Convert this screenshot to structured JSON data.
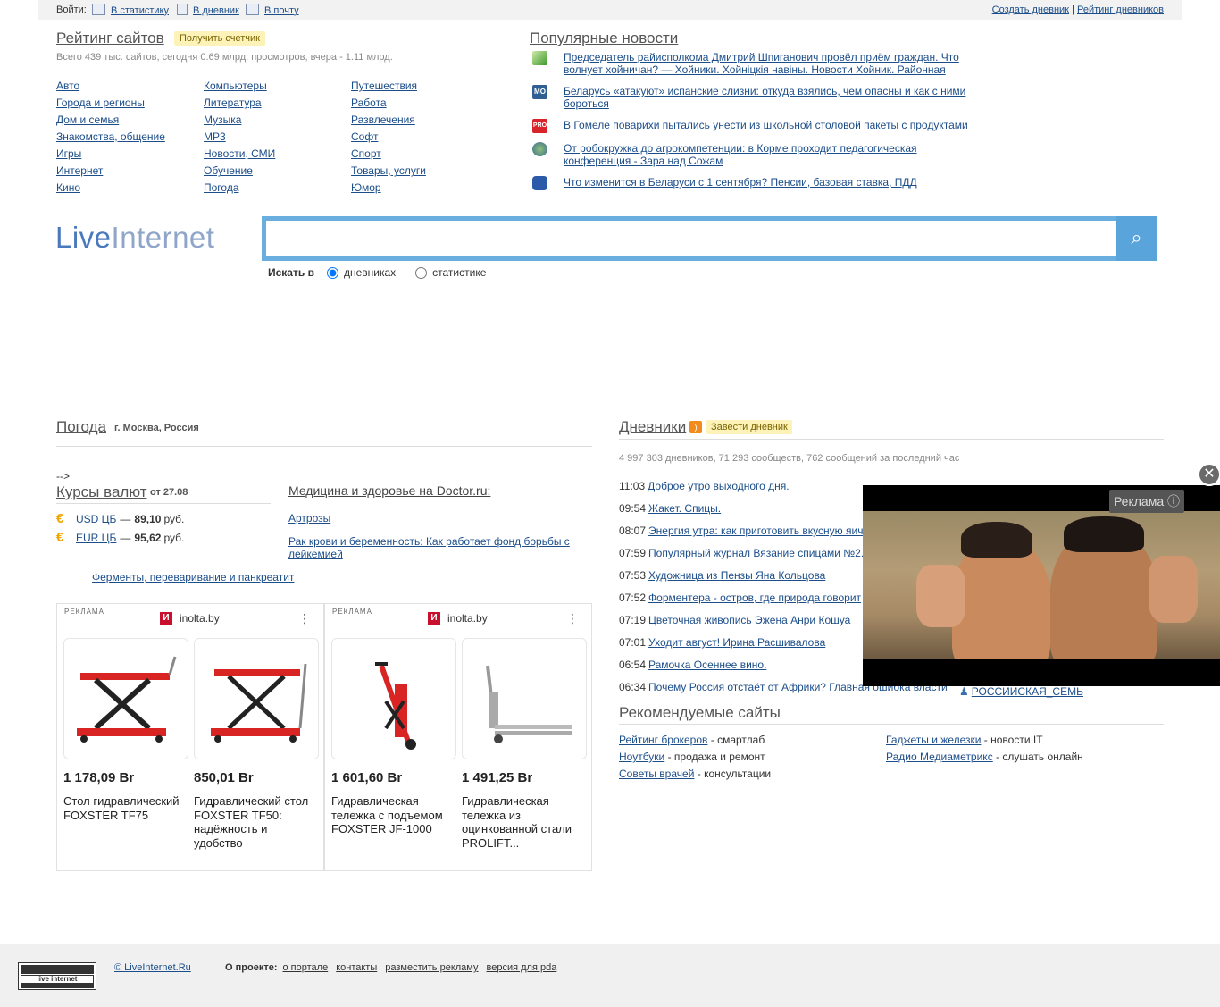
{
  "topbar": {
    "login_label": "Войти:",
    "links": [
      "В статистику",
      "В дневник",
      "В почту"
    ],
    "create_diary": "Создать дневник",
    "separator": "|",
    "diary_rating": "Рейтинг дневников"
  },
  "rating": {
    "title": "Рейтинг сайтов",
    "badge": "Получить счетчик",
    "stats": "Всего 439 тыс. сайтов, сегодня 0.69 млрд. просмотров, вчера - 1.11 млрд.",
    "col1": [
      "Авто",
      "Города и регионы",
      "Дом и семья",
      "Знакомства, общение",
      "Игры",
      "Интернет",
      "Кино"
    ],
    "col2": [
      "Компьютеры",
      "Литература",
      "Музыка",
      "MP3",
      "Новости, СМИ",
      "Обучение",
      "Погода"
    ],
    "col3": [
      "Путешествия",
      "Работа",
      "Развлечения",
      "Софт",
      "Спорт",
      "Товары, услуги",
      "Юмор"
    ]
  },
  "news": {
    "title": "Популярные новости",
    "items": [
      {
        "icon": "green-leaf-icon",
        "text": "Председатель райисполкома Дмитрий Шпиганович провёл приём граждан. Что волнует хойничан? — Хойники. Хойніцкія навіны. Новости Хойник. Районная"
      },
      {
        "icon": "mo-logo-icon",
        "badge": "MO",
        "text": "Беларусь «атакуют» испанские слизни: откуда взялись, чем опасны и как с ними бороться"
      },
      {
        "icon": "pro-logo-icon",
        "badge": "PRO",
        "text": "В Гомеле поварихи пытались унести из школьной столовой пакеты с продуктами"
      },
      {
        "icon": "globe-icon",
        "text": "От робокружка до агрокомпетенции: в Корме проходит педагогическая конференция - Зара над Сожам"
      },
      {
        "icon": "blue-swirl-icon",
        "text": "Что изменится в Беларуси с 1 сентября? Пенсии, базовая ставка, ПДД"
      }
    ]
  },
  "logo": {
    "part1": "Live",
    "part2": "Internet"
  },
  "search": {
    "placeholder": "",
    "search_in": "Искать в",
    "opt1": "дневниках",
    "opt2": "статистике"
  },
  "weather": {
    "title": "Погода",
    "city": "г. Москва, Россия"
  },
  "arrow_text": "-->",
  "currency": {
    "title": "Курсы валют",
    "date": "от 27.08",
    "rows": [
      {
        "name": "USD ЦБ",
        "dash": "—",
        "value": "89,10",
        "unit": "руб."
      },
      {
        "name": "EUR ЦБ",
        "dash": "—",
        "value": "95,62",
        "unit": "руб."
      }
    ]
  },
  "medicine": {
    "title": "Медицина и здоровье на Doctor.ru:",
    "links": [
      "Артрозы",
      "Рак крови и беременность: Как работает фонд борьбы с лейкемией",
      "Ферменты, переваривание и панкреатит"
    ]
  },
  "ads": [
    {
      "label": "РЕКЛАМА",
      "brand": "inolta.by",
      "brand_logo": "И",
      "menu": "⋮",
      "products": [
        {
          "price": "1 178,09 Br",
          "name": "Стол гидравлический FOXSTER TF75"
        },
        {
          "price": "850,01 Br",
          "name": "Гидравлический стол FOXSTER TF50: надёжность и удобство"
        }
      ]
    },
    {
      "label": "РЕКЛАМА",
      "brand": "inolta.by",
      "brand_logo": "И",
      "menu": "⋮",
      "products": [
        {
          "price": "1 601,60 Br",
          "name": "Гидравлическая тележка с подъемом FOXSTER JF-1000"
        },
        {
          "price": "1 491,25 Br",
          "name": "Гидравлическая тележка из оцинкованной стали PROLIFT..."
        }
      ]
    }
  ],
  "diaries": {
    "title": "Дневники",
    "rss": "RSS",
    "badge": "Завести дневник",
    "stats": "4 997 303 дневников, 71 293 сообществ, 762 сообщений за последний час",
    "entries": [
      {
        "time": "11:03",
        "title": "Доброе утро выходного дня."
      },
      {
        "time": "09:54",
        "title": "Жакет. Спицы."
      },
      {
        "time": "08:07",
        "title": "Энергия утра: как приготовить вкусную яич"
      },
      {
        "time": "07:59",
        "title": "Популярный журнал Вязание спицами №2."
      },
      {
        "time": "07:53",
        "title": "Художница из Пензы Яна Кольцова"
      },
      {
        "time": "07:52",
        "title": "Форментера - остров, где природа говорит"
      },
      {
        "time": "07:19",
        "title": "Цветочная живопись Эжена Анри Кошуа"
      },
      {
        "time": "07:01",
        "title": "Уходит август! Ирина Расшивалова"
      },
      {
        "time": "06:54",
        "title": "Рамочка Осеннее вино."
      },
      {
        "time": "06:34",
        "title": "Почему Россия отстаёт от Африки? Главная ошибка власти"
      }
    ],
    "author": "РОССИИСКАЯ_СЕМЬ"
  },
  "recommended": {
    "title": "Рекомендуемые сайты",
    "items": [
      {
        "link": "Рейтинг брокеров",
        "desc": " - смартлаб"
      },
      {
        "link": "Ноутбуки",
        "desc": " - продажа и ремонт"
      },
      {
        "link": "Советы врачей",
        "desc": " - консультации"
      },
      {
        "link": "Гаджеты и железки",
        "desc": " - новости IT"
      },
      {
        "link": "Радио Медиаметрикс",
        "desc": " - слушать онлайн"
      }
    ]
  },
  "video": {
    "ad_label": "Реклама ⓘ",
    "close": "✕"
  },
  "footer": {
    "counter_text": "live internet",
    "copyright": "© LiveInternet.Ru",
    "about_label": "О проекте:",
    "links": [
      "о портале",
      "контакты",
      "разместить рекламу",
      "версия для pda"
    ]
  }
}
